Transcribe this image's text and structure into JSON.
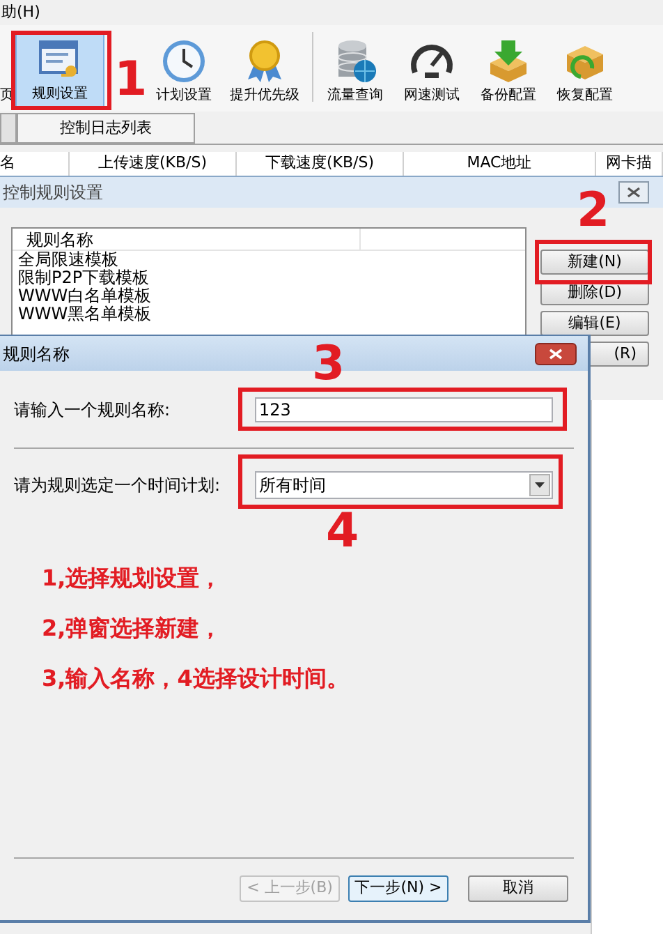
{
  "menu": {
    "help": "助(H)"
  },
  "toolbar": {
    "items": [
      {
        "label": "页",
        "selected": false
      },
      {
        "label": "规则设置",
        "selected": true
      },
      {
        "label": "计划设置",
        "selected": false
      },
      {
        "label": "提升优先级",
        "selected": false
      },
      {
        "label": "流量查询",
        "selected": false
      },
      {
        "label": "网速测试",
        "selected": false
      },
      {
        "label": "备份配置",
        "selected": false
      },
      {
        "label": "恢复配置",
        "selected": false
      }
    ]
  },
  "tabs": [
    {
      "selected": false
    },
    {
      "label": "控制日志列表",
      "selected": true
    }
  ],
  "table": {
    "columns": [
      "名",
      "上传速度(KB/S)",
      "下载速度(KB/S)",
      "MAC地址",
      "网卡描"
    ]
  },
  "rules_dialog": {
    "title": "控制规则设置",
    "list_header": "规则名称",
    "rows": [
      "全局限速模板",
      "限制P2P下载模板",
      "WWW白名单模板",
      "WWW黑名单模板"
    ],
    "buttons": [
      "新建(N)",
      "删除(D)",
      "编辑(E)",
      "(R)"
    ]
  },
  "name_dialog": {
    "title": "规则名称",
    "name_label": "请输入一个规则名称:",
    "name_value": "123",
    "schedule_label": "请为规则选定一个时间计划:",
    "schedule_value": "所有时间",
    "buttons": [
      {
        "label": "< 上一步(B)",
        "disabled": true
      },
      {
        "label": "下一步(N) >",
        "disabled": false
      },
      {
        "label": "取消",
        "disabled": false
      }
    ]
  },
  "annotations": {
    "markers": [
      "1",
      "2",
      "3",
      "4"
    ],
    "instructions": [
      "1,选择规划设置，",
      "2,弹窗选择新建，",
      "3,输入名称，4选择设计时间。"
    ]
  }
}
